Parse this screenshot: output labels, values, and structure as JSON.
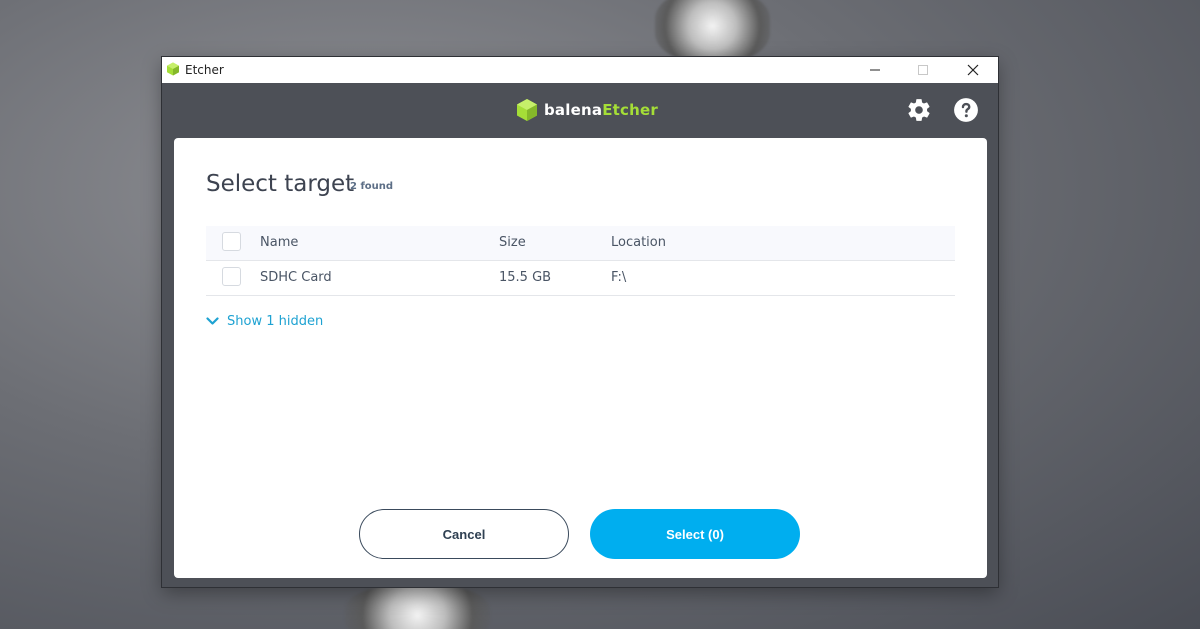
{
  "window": {
    "title": "Etcher"
  },
  "header": {
    "brand_part1": "balena",
    "brand_part2": "Etcher"
  },
  "modal": {
    "title": "Select target",
    "found_badge": "2 found",
    "table": {
      "columns": [
        "Name",
        "Size",
        "Location"
      ],
      "rows": [
        {
          "name": "SDHC Card",
          "size": "15.5 GB",
          "location": "F:\\"
        }
      ]
    },
    "show_hidden_label": "Show 1 hidden",
    "cancel_label": "Cancel",
    "select_label": "Select (0)"
  },
  "icons": {
    "app": "etcher-cube-icon",
    "settings": "gear-icon",
    "help": "help-icon",
    "expand": "chevron-down-icon"
  },
  "colors": {
    "accent": "#00aeef",
    "brand_green": "#a5de37",
    "header_bg": "#4d5057",
    "link": "#1ea2d2"
  }
}
